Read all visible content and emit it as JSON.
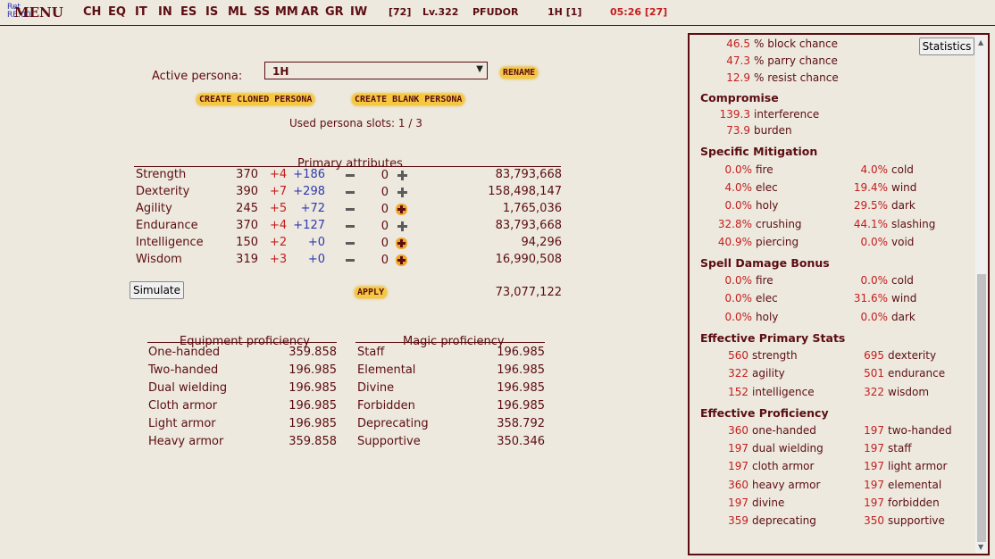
{
  "topbar": {
    "ret_label": "Ret",
    "ret_value": "RE:00",
    "menu": "MENU",
    "nav": [
      "CH",
      "EQ",
      "IT",
      "IN",
      "ES",
      "IS",
      "ML",
      "SS",
      "MM",
      "AR",
      "GR",
      "IW"
    ],
    "slots": "[72]",
    "level": "Lv.322",
    "name": "PFUDOR",
    "persona": "1H [1]",
    "clock": "05:26 [27]"
  },
  "persona": {
    "label": "Active persona:",
    "selected": "1H",
    "rename": "RENAME",
    "create_cloned": "CREATE CLONED PERSONA",
    "create_blank": "CREATE BLANK PERSONA",
    "slots_text": "Used persona slots: 1 / 3"
  },
  "primary": {
    "title": "Primary attributes",
    "rows": [
      {
        "name": "Strength",
        "base": "370",
        "mod": "+4",
        "bonus": "+186",
        "alloc": "0",
        "exp": "83,793,668"
      },
      {
        "name": "Dexterity",
        "base": "390",
        "mod": "+7",
        "bonus": "+298",
        "alloc": "0",
        "exp": "158,498,147"
      },
      {
        "name": "Agility",
        "base": "245",
        "mod": "+5",
        "bonus": "+72",
        "alloc": "0",
        "exp": "1,765,036"
      },
      {
        "name": "Endurance",
        "base": "370",
        "mod": "+4",
        "bonus": "+127",
        "alloc": "0",
        "exp": "83,793,668"
      },
      {
        "name": "Intelligence",
        "base": "150",
        "mod": "+2",
        "bonus": "+0",
        "alloc": "0",
        "exp": "94,296"
      },
      {
        "name": "Wisdom",
        "base": "319",
        "mod": "+3",
        "bonus": "+0",
        "alloc": "0",
        "exp": "16,990,508"
      }
    ],
    "simulate": "Simulate",
    "apply": "APPLY",
    "total": "73,077,122"
  },
  "equipment": {
    "title": "Equipment proficiency",
    "rows": [
      {
        "name": "One-handed",
        "value": "359.858"
      },
      {
        "name": "Two-handed",
        "value": "196.985"
      },
      {
        "name": "Dual wielding",
        "value": "196.985"
      },
      {
        "name": "Cloth armor",
        "value": "196.985"
      },
      {
        "name": "Light armor",
        "value": "196.985"
      },
      {
        "name": "Heavy armor",
        "value": "359.858"
      }
    ]
  },
  "magic": {
    "title": "Magic proficiency",
    "rows": [
      {
        "name": "Staff",
        "value": "196.985"
      },
      {
        "name": "Elemental",
        "value": "196.985"
      },
      {
        "name": "Divine",
        "value": "196.985"
      },
      {
        "name": "Forbidden",
        "value": "196.985"
      },
      {
        "name": "Deprecating",
        "value": "358.792"
      },
      {
        "name": "Supportive",
        "value": "350.346"
      }
    ]
  },
  "stats": {
    "button": "Statistics",
    "defense": [
      {
        "v": "46.5",
        "t": "% block chance"
      },
      {
        "v": "47.3",
        "t": "% parry chance"
      },
      {
        "v": "12.9",
        "t": "% resist chance"
      }
    ],
    "compromise_title": "Compromise",
    "compromise": [
      {
        "v": "139.3",
        "t": "interference"
      },
      {
        "v": "73.9",
        "t": "burden"
      }
    ],
    "mitigation_title": "Specific Mitigation",
    "mitigation": [
      {
        "v": "0.0%",
        "t": "fire"
      },
      {
        "v": "4.0%",
        "t": "cold"
      },
      {
        "v": "4.0%",
        "t": "elec"
      },
      {
        "v": "19.4%",
        "t": "wind"
      },
      {
        "v": "0.0%",
        "t": "holy"
      },
      {
        "v": "29.5%",
        "t": "dark"
      },
      {
        "v": "32.8%",
        "t": "crushing"
      },
      {
        "v": "44.1%",
        "t": "slashing"
      },
      {
        "v": "40.9%",
        "t": "piercing"
      },
      {
        "v": "0.0%",
        "t": "void"
      }
    ],
    "spell_title": "Spell Damage Bonus",
    "spell": [
      {
        "v": "0.0%",
        "t": "fire"
      },
      {
        "v": "0.0%",
        "t": "cold"
      },
      {
        "v": "0.0%",
        "t": "elec"
      },
      {
        "v": "31.6%",
        "t": "wind"
      },
      {
        "v": "0.0%",
        "t": "holy"
      },
      {
        "v": "0.0%",
        "t": "dark"
      }
    ],
    "primary_title": "Effective Primary Stats",
    "eprimary": [
      {
        "v": "560",
        "t": "strength"
      },
      {
        "v": "695",
        "t": "dexterity"
      },
      {
        "v": "322",
        "t": "agility"
      },
      {
        "v": "501",
        "t": "endurance"
      },
      {
        "v": "152",
        "t": "intelligence"
      },
      {
        "v": "322",
        "t": "wisdom"
      }
    ],
    "prof_title": "Effective Proficiency",
    "eprof": [
      {
        "v": "360",
        "t": "one-handed"
      },
      {
        "v": "197",
        "t": "two-handed"
      },
      {
        "v": "197",
        "t": "dual wielding"
      },
      {
        "v": "197",
        "t": "staff"
      },
      {
        "v": "197",
        "t": "cloth armor"
      },
      {
        "v": "197",
        "t": "light armor"
      },
      {
        "v": "360",
        "t": "heavy armor"
      },
      {
        "v": "197",
        "t": "elemental"
      },
      {
        "v": "197",
        "t": "divine"
      },
      {
        "v": "197",
        "t": "forbidden"
      },
      {
        "v": "359",
        "t": "deprecating"
      },
      {
        "v": "350",
        "t": "supportive"
      }
    ]
  }
}
